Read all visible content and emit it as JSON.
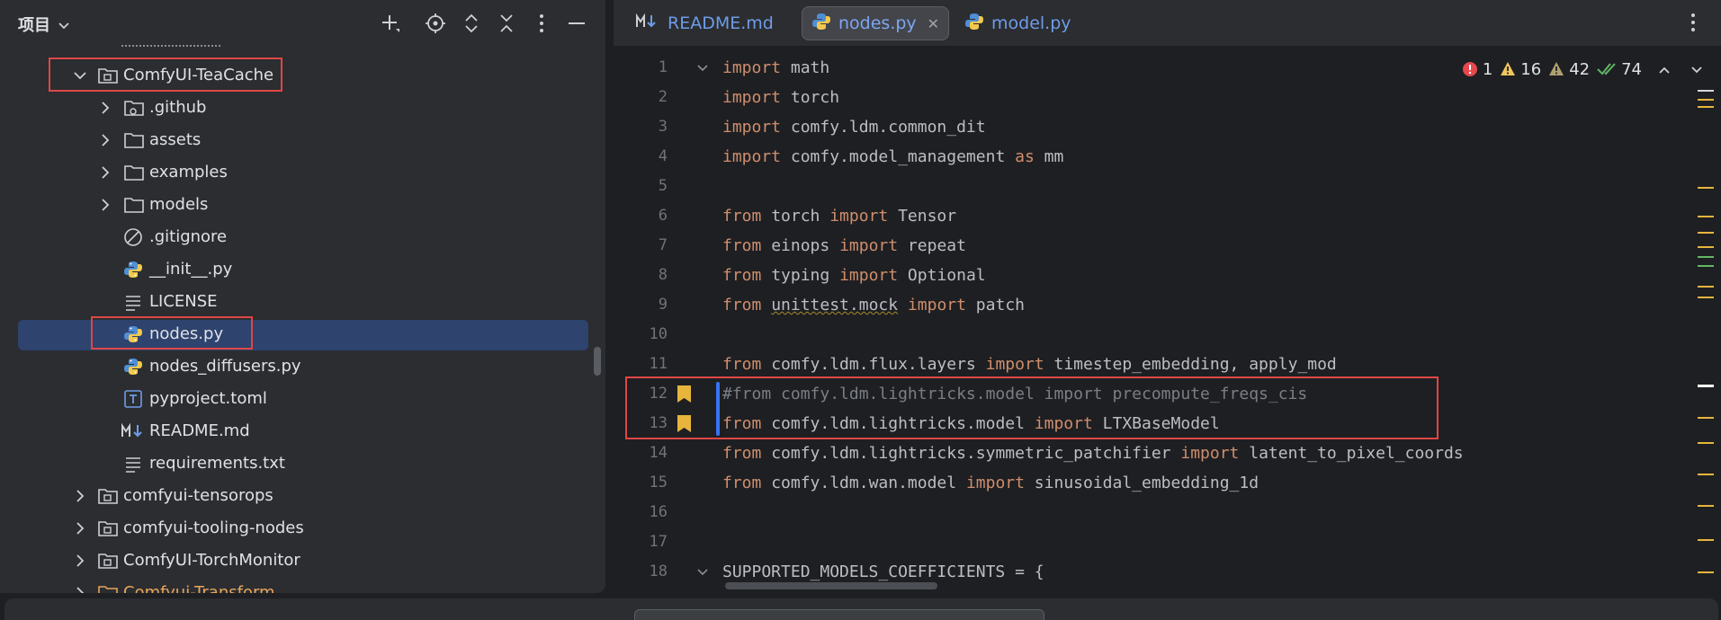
{
  "project_panel": {
    "title": "项目",
    "tree": [
      {
        "label": "ComfyUI-TeaCache",
        "type": "module-folder",
        "expanded": true
      },
      {
        "label": ".github",
        "type": "folder-git"
      },
      {
        "label": "assets",
        "type": "folder"
      },
      {
        "label": "examples",
        "type": "folder"
      },
      {
        "label": "models",
        "type": "folder"
      },
      {
        "label": ".gitignore",
        "type": "ignore-file"
      },
      {
        "label": "__init__.py",
        "type": "python-file"
      },
      {
        "label": "LICENSE",
        "type": "text-file"
      },
      {
        "label": "nodes.py",
        "type": "python-file",
        "selected": true
      },
      {
        "label": "nodes_diffusers.py",
        "type": "python-file"
      },
      {
        "label": "pyproject.toml",
        "type": "toml-file"
      },
      {
        "label": "README.md",
        "type": "markdown-file"
      },
      {
        "label": "requirements.txt",
        "type": "text-file"
      },
      {
        "label": "comfyui-tensorops",
        "type": "module-folder"
      },
      {
        "label": "comfyui-tooling-nodes",
        "type": "module-folder"
      },
      {
        "label": "ComfyUI-TorchMonitor",
        "type": "module-folder"
      },
      {
        "label": "Comfyui-Transform",
        "type": "module-folder",
        "color": "#e8a55c"
      }
    ]
  },
  "editor": {
    "tabs": [
      {
        "label": "README.md",
        "icon": "markdown-icon"
      },
      {
        "label": "nodes.py",
        "icon": "python-icon",
        "active": true
      },
      {
        "label": "model.py",
        "icon": "python-icon"
      }
    ],
    "inspections": {
      "errors": "1",
      "warnings": "16",
      "weak_warnings": "42",
      "ok": "74"
    },
    "lines": [
      {
        "n": "1",
        "kw1": "import",
        "rest": " math"
      },
      {
        "n": "2",
        "kw1": "import",
        "rest": " torch"
      },
      {
        "n": "3",
        "kw1": "import",
        "rest": " comfy.ldm.common_dit"
      },
      {
        "n": "4",
        "kw1": "import",
        "mid": " comfy.model_management ",
        "kw2": "as",
        "rest": " mm"
      },
      {
        "n": "5"
      },
      {
        "n": "6",
        "kw1": "from",
        "mid": " torch ",
        "kw2": "import",
        "rest": " Tensor"
      },
      {
        "n": "7",
        "kw1": "from",
        "mid": " einops ",
        "kw2": "import",
        "rest": " repeat"
      },
      {
        "n": "8",
        "kw1": "from",
        "mid": " typing ",
        "kw2": "import",
        "rest": " Optional"
      },
      {
        "n": "9",
        "kw1": "from",
        "uw": "unittest.mock",
        "kw2": "import",
        "rest": " patch"
      },
      {
        "n": "10"
      },
      {
        "n": "11",
        "kw1": "from",
        "mid": " comfy.ldm.flux.layers ",
        "kw2": "import",
        "rest": " timestep_embedding, apply_mod"
      },
      {
        "n": "12",
        "comment": "#from comfy.ldm.lightricks.model import precompute_freqs_cis"
      },
      {
        "n": "13",
        "kw1": "from",
        "mid": " comfy.ldm.lightricks.model ",
        "kw2": "import",
        "rest": " LTXBaseModel"
      },
      {
        "n": "14",
        "kw1": "from",
        "mid": " comfy.ldm.lightricks.symmetric_patchifier ",
        "kw2": "import",
        "rest": " latent_to_pixel_coords"
      },
      {
        "n": "15",
        "kw1": "from",
        "mid": " comfy.ldm.wan.model ",
        "kw2": "import",
        "rest": " sinusoidal_embedding_1d"
      },
      {
        "n": "16"
      },
      {
        "n": "17"
      },
      {
        "n": "18",
        "rest": "SUPPORTED_MODELS_COEFFICIENTS = {"
      }
    ]
  },
  "colors": {
    "keyword": "#cf8e6d",
    "comment": "#7a7e85",
    "selection": "#2e436e",
    "highlight_box": "#e04646",
    "error": "#e5484d",
    "warning": "#f2c55c",
    "ok": "#5fb865"
  }
}
